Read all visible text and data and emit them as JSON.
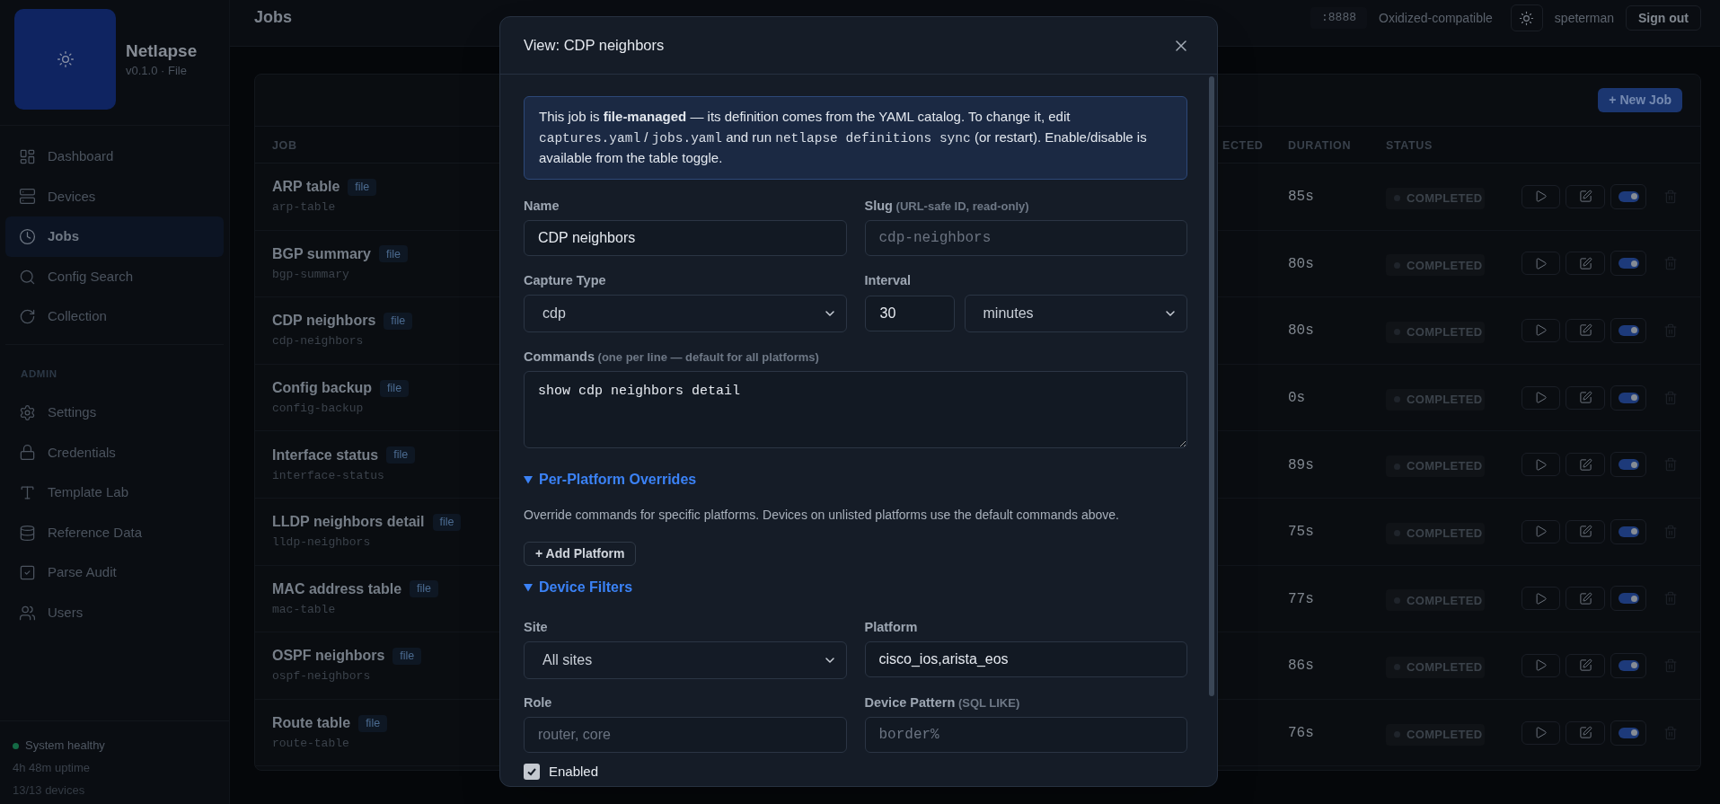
{
  "sidebar": {
    "brand": {
      "name": "Netlapse",
      "version": "v0.1.0 · File"
    },
    "nav": [
      {
        "label": "Dashboard",
        "selected": false
      },
      {
        "label": "Devices",
        "selected": false
      },
      {
        "label": "Jobs",
        "selected": true
      },
      {
        "label": "Config Search",
        "selected": false
      },
      {
        "label": "Collection",
        "selected": false
      }
    ],
    "admin": {
      "heading": "ADMIN",
      "items": [
        {
          "label": "Settings",
          "selected": false
        },
        {
          "label": "Credentials",
          "selected": false
        },
        {
          "label": "Template Lab",
          "selected": false
        },
        {
          "label": "Reference Data",
          "selected": false
        },
        {
          "label": "Parse Audit",
          "selected": false
        },
        {
          "label": "Users",
          "selected": false
        }
      ]
    },
    "status": {
      "label": "System healthy",
      "healthy": true,
      "uptime": "4h 48m uptime",
      "devices": "13/13 devices"
    }
  },
  "topbar": {
    "title": "Jobs",
    "port": ":8888",
    "mode": "Oxidized-compatible",
    "user": "speterman",
    "sign_out": "Sign out"
  },
  "jobs": {
    "new_button": "+ New Job",
    "columns": [
      {
        "label": "JOB"
      },
      {
        "label": "ECTED"
      },
      {
        "label": "DURATION"
      },
      {
        "label": "STATUS"
      }
    ],
    "rows": [
      {
        "name": "ARP table",
        "tag": "file",
        "slug": "arp-table",
        "duration": "85s",
        "status": "COMPLETED",
        "enabled": true
      },
      {
        "name": "BGP summary",
        "tag": "file",
        "slug": "bgp-summary",
        "duration": "80s",
        "status": "COMPLETED",
        "enabled": true
      },
      {
        "name": "CDP neighbors",
        "tag": "file",
        "slug": "cdp-neighbors",
        "duration": "80s",
        "status": "COMPLETED",
        "enabled": true
      },
      {
        "name": "Config backup",
        "tag": "file",
        "slug": "config-backup",
        "duration": "0s",
        "status": "COMPLETED",
        "enabled": true
      },
      {
        "name": "Interface status",
        "tag": "file",
        "slug": "interface-status",
        "duration": "89s",
        "status": "COMPLETED",
        "enabled": true
      },
      {
        "name": "LLDP neighbors detail",
        "tag": "file",
        "slug": "lldp-neighbors",
        "duration": "75s",
        "status": "COMPLETED",
        "enabled": true
      },
      {
        "name": "MAC address table",
        "tag": "file",
        "slug": "mac-table",
        "duration": "77s",
        "status": "COMPLETED",
        "enabled": true
      },
      {
        "name": "OSPF neighbors",
        "tag": "file",
        "slug": "ospf-neighbors",
        "duration": "86s",
        "status": "COMPLETED",
        "enabled": true
      },
      {
        "name": "Route table",
        "tag": "file",
        "slug": "route-table",
        "duration": "76s",
        "status": "COMPLETED",
        "enabled": true
      }
    ]
  },
  "modal": {
    "title": "View: CDP neighbors",
    "notice": [
      {
        "kind": "text",
        "text": "This job is **file-managed** — its definition comes from the YAML catalog. To change it, edit "
      },
      {
        "kind": "code",
        "text": "captures.yaml"
      },
      {
        "kind": "text",
        "text": " / "
      },
      {
        "kind": "code",
        "text": "jobs.yaml"
      },
      {
        "kind": "text",
        "text": " and run "
      },
      {
        "kind": "code",
        "text": "netlapse definitions sync"
      },
      {
        "kind": "text",
        "text": " (or restart). Enable/disable is available from the table toggle."
      }
    ],
    "name": {
      "kind": "text",
      "label": "Name",
      "value": "CDP neighbors"
    },
    "slug": {
      "kind": "code",
      "label": "Slug",
      "hint": "(URL-safe ID, read-only)",
      "value": "cdp-neighbors",
      "disabled": true
    },
    "capture_type": {
      "kind": "select",
      "label": "Capture Type",
      "value": "cdp"
    },
    "interval": {
      "label": "Interval",
      "value": "30",
      "unit": "minutes"
    },
    "commands": {
      "kind": "textarea",
      "label": "Commands",
      "hint": "(one per line — default for all platforms)",
      "value": "show cdp neighbors detail"
    },
    "overrides": {
      "title": "Per-Platform Overrides",
      "expanded": true,
      "description": "Override commands for specific platforms. Devices on unlisted platforms use the default commands above.",
      "add_button": "+ Add Platform"
    },
    "device_filters": {
      "title": "Device Filters",
      "expanded": true,
      "fields": [
        {
          "kind": "select",
          "label": "Site",
          "value": "All sites"
        },
        {
          "kind": "text",
          "label": "Platform",
          "value": "cisco_ios,arista_eos"
        },
        {
          "kind": "text",
          "label": "Role",
          "placeholder": "router, core"
        },
        {
          "kind": "code",
          "label": "Device Pattern",
          "hint": "(SQL LIKE)",
          "placeholder": "border%"
        }
      ]
    },
    "enabled": {
      "label": "Enabled",
      "checked": true
    }
  }
}
